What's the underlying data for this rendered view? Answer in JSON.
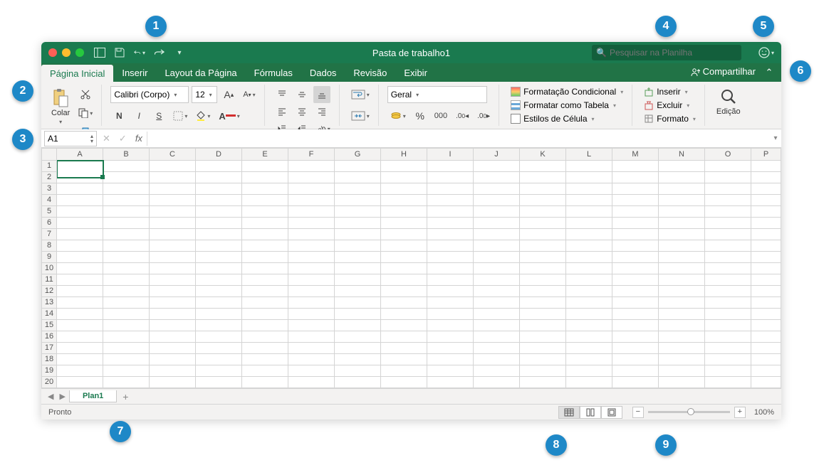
{
  "titlebar": {
    "title": "Pasta de trabalho1",
    "search_placeholder": "Pesquisar na Planilha"
  },
  "tabs": [
    "Página Inicial",
    "Inserir",
    "Layout da Página",
    "Fórmulas",
    "Dados",
    "Revisão",
    "Exibir"
  ],
  "active_tab": 0,
  "share_label": "Compartilhar",
  "ribbon": {
    "paste": "Colar",
    "font_name": "Calibri (Corpo)",
    "font_size": "12",
    "bold": "N",
    "italic": "I",
    "underline": "S",
    "number_format": "Geral",
    "decimals": "000",
    "conditional": "Formatação Condicional",
    "table_format": "Formatar como Tabela",
    "cell_styles": "Estilos de Célula",
    "insert": "Inserir",
    "delete": "Excluir",
    "format": "Formato",
    "editing": "Edição"
  },
  "formula_bar": {
    "name_box": "A1",
    "fx": "fx",
    "formula": ""
  },
  "columns": [
    "A",
    "B",
    "C",
    "D",
    "E",
    "F",
    "G",
    "H",
    "I",
    "J",
    "K",
    "L",
    "M",
    "N",
    "O",
    "P"
  ],
  "row_count": 20,
  "selected_cell": {
    "row": 1,
    "col": 0
  },
  "sheets": [
    "Plan1"
  ],
  "status": {
    "text": "Pronto",
    "zoom": "100%"
  },
  "callouts": {
    "1": 1,
    "2": 2,
    "3": 3,
    "4": 4,
    "5": 5,
    "6": 6,
    "7": 7,
    "8": 8,
    "9": 9
  }
}
